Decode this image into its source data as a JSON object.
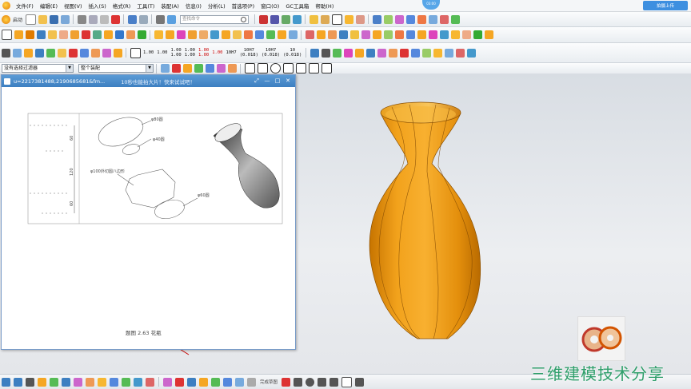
{
  "menubar": {
    "items": [
      "文件(F)",
      "编辑(E)",
      "视图(V)",
      "插入(S)",
      "格式(R)",
      "工具(T)",
      "装配(A)",
      "信息(I)",
      "分析(L)",
      "首选项(P)",
      "窗口(O)",
      "GC工具箱",
      "帮助(H)"
    ]
  },
  "toolbar1": {
    "start_label": "启动",
    "search_placeholder": "查找命令",
    "upload_label": "拍摄上传"
  },
  "toolbar3": {
    "nums": [
      "1.00",
      "1.00",
      "1.00\n1.00",
      "1.00\n1.00",
      "1.00\n1.00",
      "1.00",
      "10H7",
      "10H7\n(0.018)",
      "10H7\n(0.018)",
      "10\n(0.018)"
    ]
  },
  "filterbar": {
    "filter_value": "没有选择过滤器",
    "assembly_value": "整个装配"
  },
  "image_window": {
    "title": "u=2217381488,2190685681&fm...",
    "subtitle": "10秒也能拍大片！快来试试吧！",
    "caption": "题图 2.63    花瓶",
    "drawing_labels": [
      "φ80圆",
      "φ40圆",
      "φ100外切圆八边形",
      "φ60圆",
      "60",
      "120",
      "60"
    ]
  },
  "rec_badge": "03:00",
  "statusbar": {
    "sketch_label": "完成草图"
  },
  "watermark": "三维建模技术分享",
  "colors": {
    "vase": "#f5a623",
    "vase_dark": "#b86a00",
    "window_title": "#4a8ccf",
    "watermark": "#2e9e6a"
  }
}
